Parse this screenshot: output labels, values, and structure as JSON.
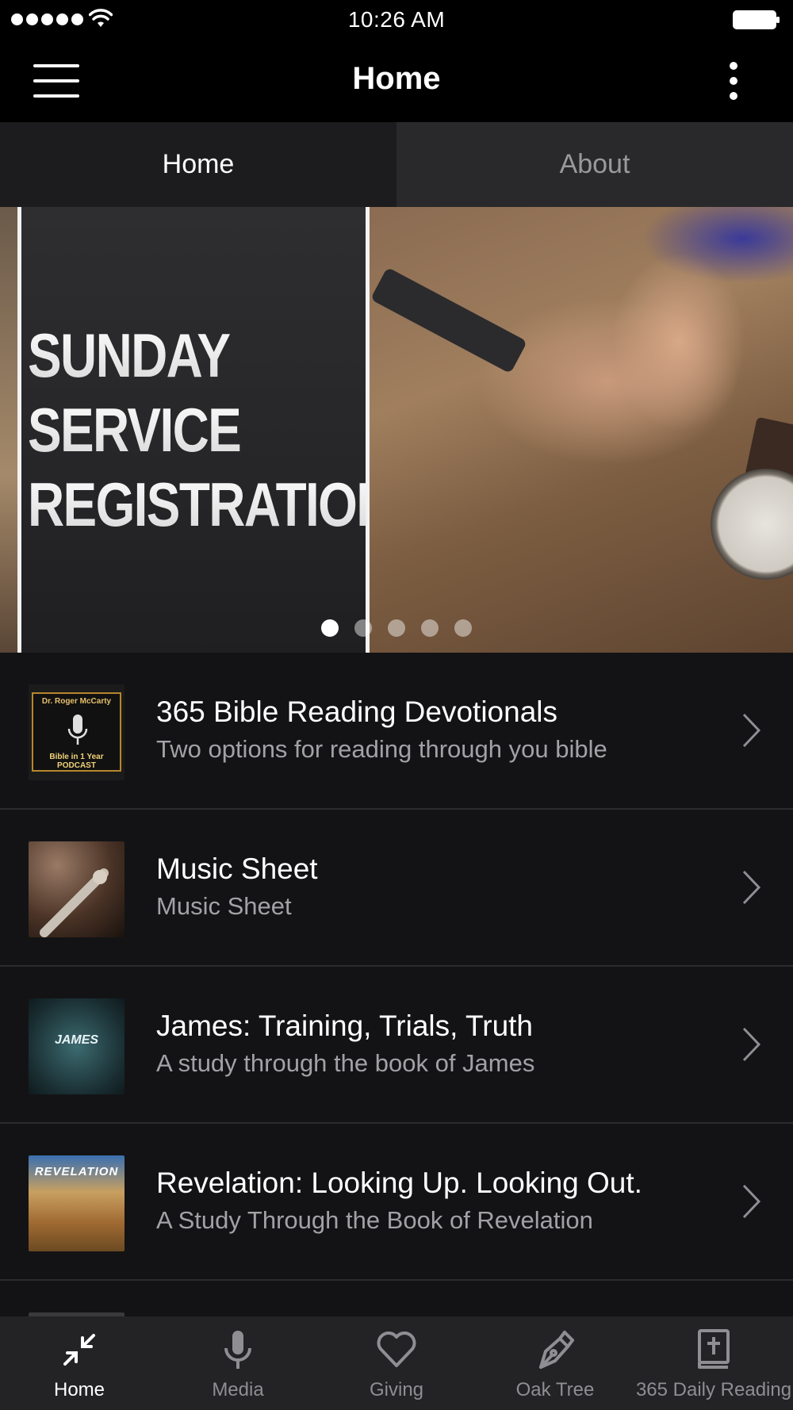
{
  "status_bar": {
    "time": "10:26 AM",
    "signal_icon": "signal-dots-icon",
    "wifi_icon": "wifi-icon",
    "battery_icon": "battery-icon"
  },
  "nav": {
    "title": "Home",
    "menu_icon": "hamburger-menu-icon",
    "more_icon": "more-vertical-icon"
  },
  "tabs": [
    {
      "label": "Home",
      "active": true
    },
    {
      "label": "About",
      "active": false
    }
  ],
  "carousel": {
    "banner_lines": [
      "SUNDAY",
      "SERVICE",
      "REGISTRATIONS"
    ],
    "page_count": 5,
    "active_page": 1
  },
  "list": {
    "items": [
      {
        "title": "365 Bible Reading Devotionals",
        "subtitle": "Two options for reading through you bible",
        "thumb_top": "Dr. Roger McCarty",
        "thumb_bottom": "Bible in 1 Year PODCAST"
      },
      {
        "title": "Music Sheet",
        "subtitle": "Music Sheet"
      },
      {
        "title": "James: Training, Trials, Truth",
        "subtitle": "A study through the book of James",
        "thumb_caption": "JAMES"
      },
      {
        "title": "Revelation: Looking Up. Looking Out.",
        "subtitle": "A Study Through the Book of Revelation",
        "thumb_caption": "REVELATION"
      }
    ]
  },
  "tabbar": {
    "items": [
      {
        "label": "Home",
        "icon": "collapse-arrows-icon",
        "active": true
      },
      {
        "label": "Media",
        "icon": "microphone-icon",
        "active": false
      },
      {
        "label": "Giving",
        "icon": "heart-icon",
        "active": false
      },
      {
        "label": "Oak Tree",
        "icon": "pen-nib-icon",
        "active": false
      },
      {
        "label": "365 Daily Reading",
        "icon": "bible-cross-icon",
        "active": false
      }
    ]
  },
  "colors": {
    "background": "#131315",
    "nav_background": "#000000",
    "tab_active": "#1c1c1e",
    "tab_inactive": "#29292b",
    "tabbar_background": "#232325",
    "subtitle": "#a2a2a6",
    "inactive_label": "#8e8e93"
  }
}
